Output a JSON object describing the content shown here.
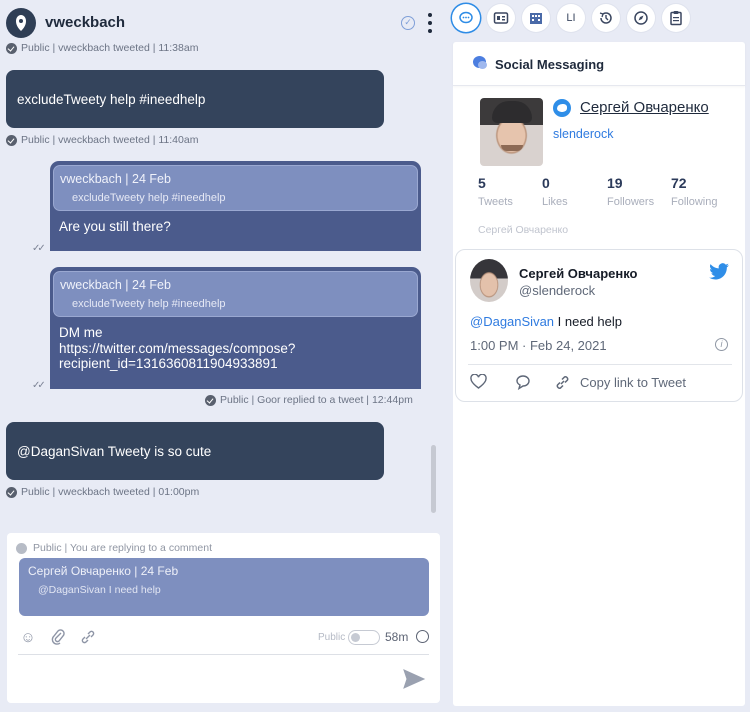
{
  "chat": {
    "title": "vweckbach",
    "messages": [
      {
        "meta": "Public | vweckbach tweeted | 11:38am"
      },
      {
        "text": "excludeTweety help #ineedhelp",
        "meta": "Public | vweckbach tweeted | 11:40am"
      },
      {
        "quote_head": "vweckbach | 24 Feb",
        "quote_body": "excludeTweety help #ineedhelp",
        "text": "Are you still there?"
      },
      {
        "quote_head": "vweckbach | 24 Feb",
        "quote_body": "excludeTweety help #ineedhelp",
        "text_lines": [
          "DM me",
          "https://twitter.com/messages/compose?",
          "recipient_id=1316360811904933891"
        ],
        "meta": "Public | Goor replied to a tweet | 12:44pm"
      },
      {
        "text": "@DaganSivan Tweety is so cute",
        "meta": "Public | vweckbach tweeted | 01:00pm"
      }
    ]
  },
  "composer": {
    "meta": "Public  |  You are replying to a comment",
    "quote_head": "Сергей Овчаренко | 24 Feb",
    "quote_body": "@DaganSivan I need help",
    "public_label": "Public",
    "timer": "58m"
  },
  "toolbar": {
    "buttons": [
      {
        "name": "chat-icon",
        "label": "",
        "active": true
      },
      {
        "name": "contact-card-icon",
        "label": ""
      },
      {
        "name": "building-icon",
        "label": ""
      },
      {
        "name": "li-button",
        "label": "LI"
      },
      {
        "name": "history-icon",
        "label": ""
      },
      {
        "name": "compass-icon",
        "label": ""
      },
      {
        "name": "clipboard-icon",
        "label": ""
      }
    ]
  },
  "panel": {
    "title": "Social Messaging",
    "profile": {
      "name": "Сергей Овчаренко",
      "handle": "slenderock",
      "subname": "Сергей Овчаренко",
      "stats": [
        {
          "num": "5",
          "label": "Tweets"
        },
        {
          "num": "0",
          "label": "Likes"
        },
        {
          "num": "19",
          "label": "Followers"
        },
        {
          "num": "72",
          "label": "Following"
        }
      ]
    },
    "tweet": {
      "name": "Сергей Овчаренко",
      "handle": "@slenderock",
      "mention": "@DaganSivan",
      "text": " I need help",
      "time": "1:00 PM · Feb 24, 2021",
      "copy_link": "Copy link to Tweet"
    }
  },
  "colors": {
    "incoming_bubble": "#34445c",
    "outgoing_bubble": "#4b5b8c",
    "quote": "#7e8fbf",
    "link": "#2f7be0",
    "twitter_blue": "#2f8ee8"
  }
}
